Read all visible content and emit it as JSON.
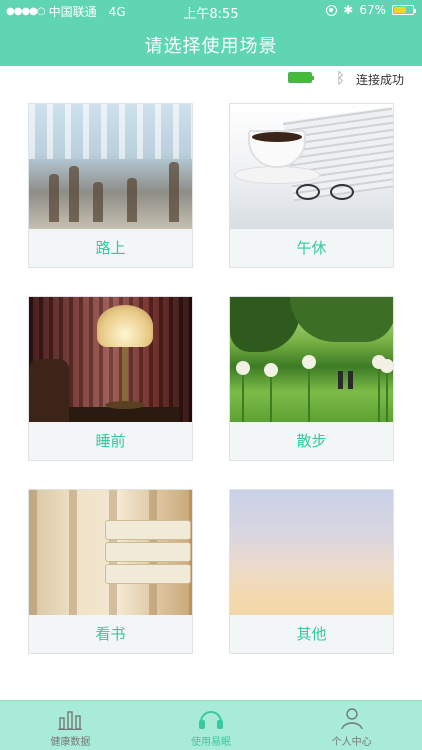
{
  "status_bar": {
    "signal": "●●●●○",
    "carrier": "中国联通",
    "network": "4G",
    "time": "上午8:55",
    "battery": "67%",
    "battery_level": 0.67
  },
  "nav": {
    "title": "请选择使用场景"
  },
  "device": {
    "connection_text": "连接成功"
  },
  "scenes": [
    {
      "label": "路上",
      "image": "commute-station-photo"
    },
    {
      "label": "午休",
      "image": "coffee-newspaper-photo"
    },
    {
      "label": "睡前",
      "image": "bedside-lamp-photo"
    },
    {
      "label": "散步",
      "image": "park-walk-photo"
    },
    {
      "label": "看书",
      "image": "books-shelf-photo"
    },
    {
      "label": "其他",
      "image": "soft-gradient-photo"
    }
  ],
  "tabs": [
    {
      "label": "健康数据",
      "icon": "bar-chart-icon",
      "active": false
    },
    {
      "label": "使用易眠",
      "icon": "headphones-icon",
      "active": true
    },
    {
      "label": "个人中心",
      "icon": "person-icon",
      "active": false
    }
  ],
  "colors": {
    "accent": "#5fd5b3",
    "label_text": "#34c9a0",
    "tabbar_bg": "#a8ecd7",
    "device_battery": "#44bb3a",
    "phone_battery": "#f3d42a"
  }
}
